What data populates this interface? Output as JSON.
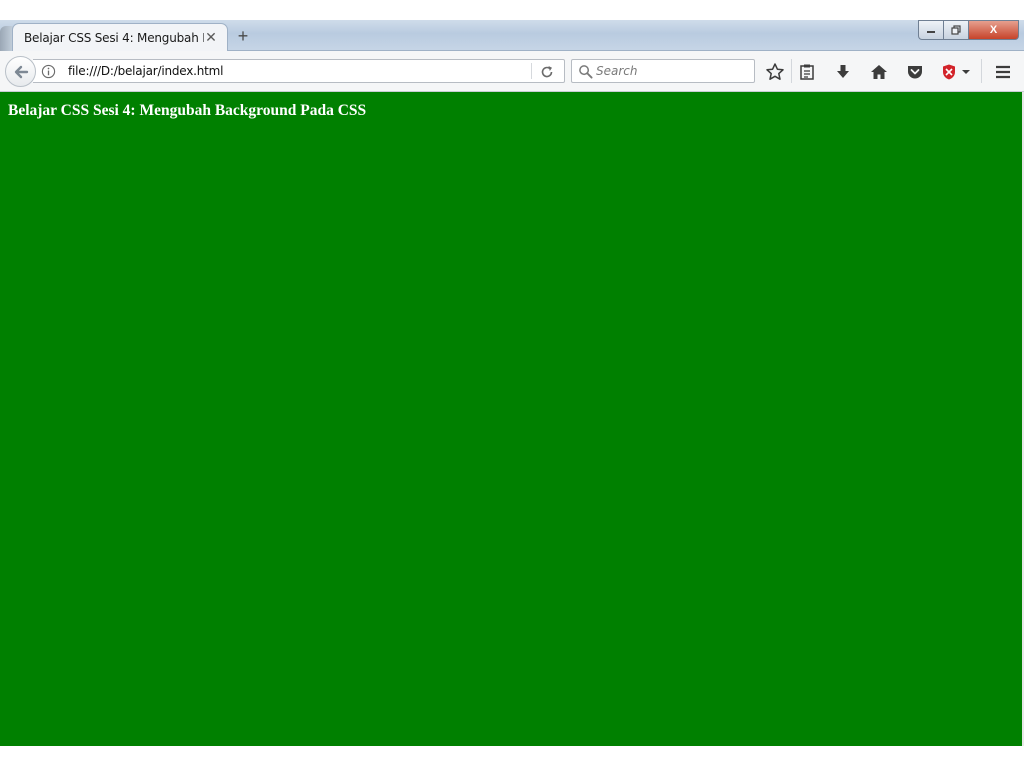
{
  "tab": {
    "title": "Belajar CSS Sesi 4: Mengubah B...",
    "close_glyph": "✕",
    "new_tab_glyph": "+"
  },
  "window_controls": {
    "close_glyph": "X"
  },
  "address_bar": {
    "url": "file:///D:/belajar/index.html"
  },
  "search_bar": {
    "placeholder": "Search"
  },
  "toolbar_icons": [
    "back-arrow-icon",
    "info-icon",
    "reload-icon",
    "search-icon",
    "bookmark-star-icon",
    "reading-list-icon",
    "download-icon",
    "home-icon",
    "pocket-icon",
    "adblock-icon",
    "hamburger-menu-icon"
  ],
  "page": {
    "heading": "Belajar CSS Sesi 4: Mengubah Background Pada CSS",
    "background_color": "#008000",
    "text_color": "#ffffff"
  }
}
